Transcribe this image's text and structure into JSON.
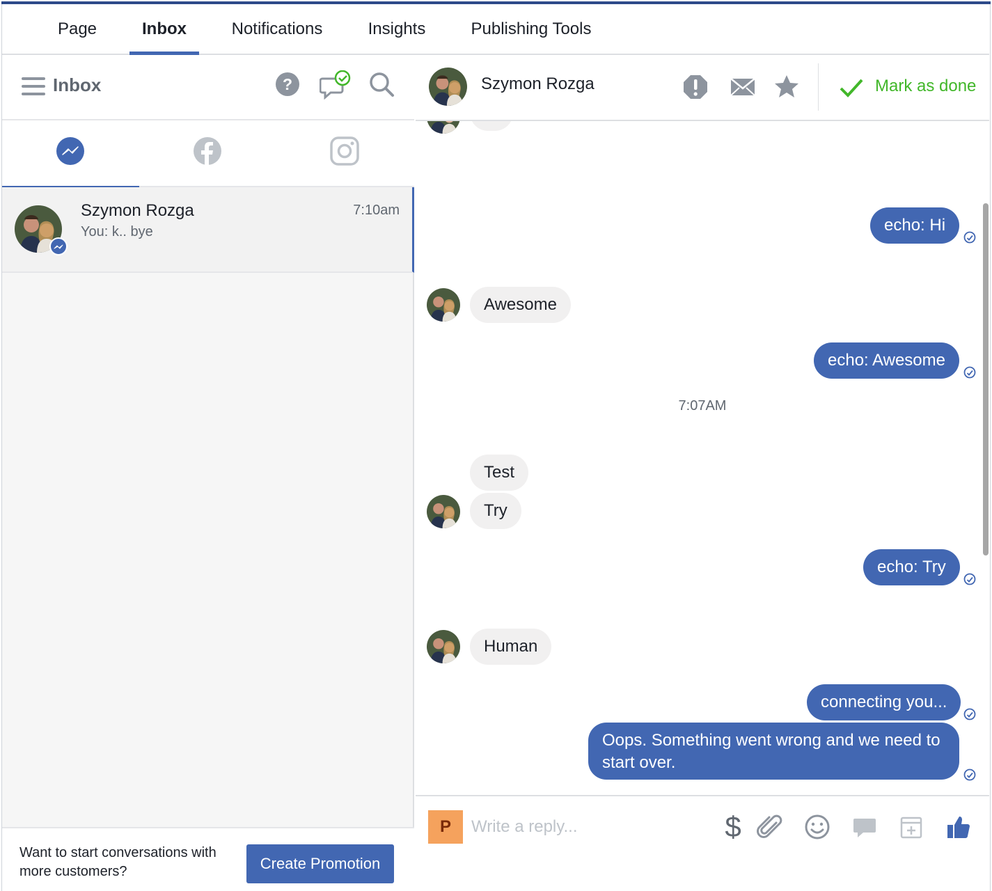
{
  "nav": {
    "tabs": [
      {
        "label": "Page"
      },
      {
        "label": "Inbox"
      },
      {
        "label": "Notifications"
      },
      {
        "label": "Insights"
      },
      {
        "label": "Publishing Tools"
      }
    ]
  },
  "inbox": {
    "title": "Inbox",
    "conversation": {
      "name": "Szymon Rozga",
      "time": "7:10am",
      "preview": "You: k.. bye"
    },
    "promo": {
      "text": "Want to start conversations with more customers?",
      "button_label": "Create Promotion"
    }
  },
  "thread": {
    "contact_name": "Szymon Rozga",
    "mark_done_label": "Mark as done",
    "messages": [
      {
        "dir": "out",
        "text": "echo: Hi"
      },
      {
        "dir": "in",
        "text": "Awesome"
      },
      {
        "dir": "out",
        "text": "echo: Awesome"
      },
      {
        "dir": "time",
        "text": "7:07AM"
      },
      {
        "dir": "in",
        "text": "Test"
      },
      {
        "dir": "in",
        "text": "Try"
      },
      {
        "dir": "out",
        "text": "echo: Try"
      },
      {
        "dir": "in",
        "text": "Human"
      },
      {
        "dir": "out",
        "text": "connecting you..."
      },
      {
        "dir": "out",
        "text": "Oops. Something went wrong and we need to start over."
      }
    ]
  },
  "composer": {
    "page_initial": "P",
    "placeholder": "Write a reply...",
    "dollar": "$"
  },
  "colors": {
    "accent": "#4267b2",
    "done_green": "#42b72a",
    "bubble_in": "#f1f0f0"
  },
  "icons": [
    "menu-icon",
    "help-icon",
    "chat-check-icon",
    "search-icon",
    "messenger-icon",
    "facebook-icon",
    "instagram-icon",
    "spam-icon",
    "envelope-icon",
    "star-icon",
    "checkmark-icon",
    "sent-tick-icon",
    "attachment-icon",
    "emoji-icon",
    "saved-reply-icon",
    "appointment-icon",
    "thumbs-up-icon"
  ]
}
